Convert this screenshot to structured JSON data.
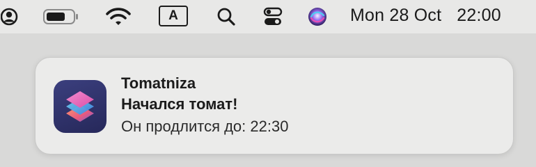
{
  "menubar": {
    "icons": {
      "user": "user-circle-icon",
      "battery": "battery-icon",
      "wifi": "wifi-icon",
      "input_source": "input-source-icon",
      "search": "search-icon",
      "control_center": "control-center-icon",
      "siri": "siri-icon"
    },
    "input_source_label": "A",
    "date": "Mon 28 Oct",
    "time": "22:00"
  },
  "notification": {
    "app_name": "Tomatniza",
    "title": "Начался томат!",
    "body": "Он продлится до: 22:30",
    "icon": "shortcuts-app-icon"
  },
  "colors": {
    "menubar_bg": "#e8e8e7",
    "desktop_bg": "#d9d9d8",
    "notification_bg": "#ebebea",
    "icon_bg": "#2e3168"
  }
}
